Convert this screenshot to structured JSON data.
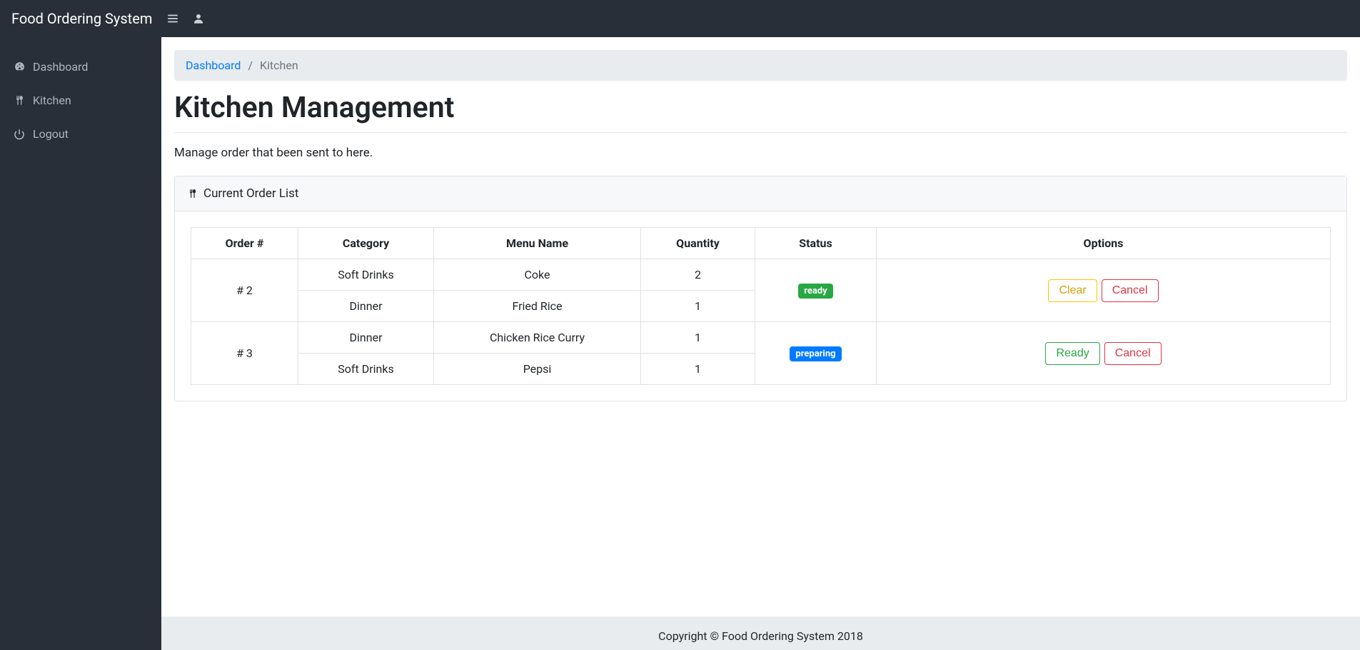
{
  "brand": "Food Ordering System",
  "sidebar": {
    "items": [
      {
        "label": "Dashboard",
        "icon": "gauge-icon"
      },
      {
        "label": "Kitchen",
        "icon": "utensils-icon"
      },
      {
        "label": "Logout",
        "icon": "power-icon"
      }
    ]
  },
  "breadcrumb": {
    "root": "Dashboard",
    "current": "Kitchen"
  },
  "page": {
    "title": "Kitchen Management",
    "subtitle": "Manage order that been sent to here."
  },
  "card": {
    "title": "Current Order List"
  },
  "table": {
    "headers": [
      "Order #",
      "Category",
      "Menu Name",
      "Quantity",
      "Status",
      "Options"
    ]
  },
  "orders": [
    {
      "order_no": "# 2",
      "status_label": "ready",
      "status_class": "badge-green",
      "primary_btn": "Clear",
      "primary_class": "btn-warning",
      "cancel_btn": "Cancel",
      "items": [
        {
          "category": "Soft Drinks",
          "menu": "Coke",
          "qty": "2"
        },
        {
          "category": "Dinner",
          "menu": "Fried Rice",
          "qty": "1"
        }
      ]
    },
    {
      "order_no": "# 3",
      "status_label": "preparing",
      "status_class": "badge-blue",
      "primary_btn": "Ready",
      "primary_class": "btn-success",
      "cancel_btn": "Cancel",
      "items": [
        {
          "category": "Dinner",
          "menu": "Chicken Rice Curry",
          "qty": "1"
        },
        {
          "category": "Soft Drinks",
          "menu": "Pepsi",
          "qty": "1"
        }
      ]
    }
  ],
  "footer": "Copyright © Food Ordering System 2018"
}
